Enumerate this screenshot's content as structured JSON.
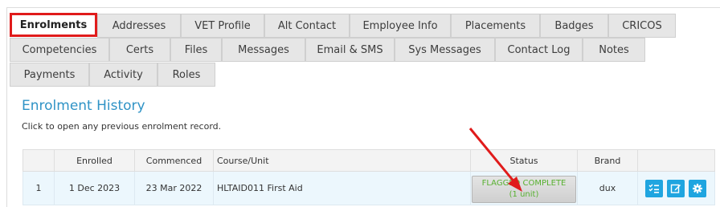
{
  "tabs_row1": [
    "Enrolments",
    "Addresses",
    "VET Profile",
    "Alt Contact",
    "Employee Info",
    "Placements",
    "Badges",
    "CRICOS"
  ],
  "tabs_row2": [
    "Competencies",
    "Certs",
    "Files",
    "Messages",
    "Email & SMS",
    "Sys Messages",
    "Contact Log",
    "Notes"
  ],
  "tabs_row3": [
    "Payments",
    "Activity",
    "Roles"
  ],
  "section": {
    "title": "Enrolment History",
    "subtitle": "Click to open any previous enrolment record."
  },
  "table": {
    "headers": [
      "",
      "Enrolled",
      "Commenced",
      "Course/Unit",
      "Status",
      "Brand",
      ""
    ],
    "rows": [
      {
        "num": "1",
        "enrolled": "1 Dec 2023",
        "commenced": "23 Mar 2022",
        "course": "HLTAID011 First Aid",
        "status_line1": "FLAGGED COMPLETE",
        "status_line2": "(1 unit)",
        "brand": "dux"
      }
    ]
  },
  "icons": [
    "checklist-icon",
    "edit-icon",
    "gear-icon"
  ],
  "colors": {
    "accent": "#2f93c6",
    "highlight": "#e01b1b",
    "status": "#57b030",
    "action": "#1fa5e0"
  }
}
